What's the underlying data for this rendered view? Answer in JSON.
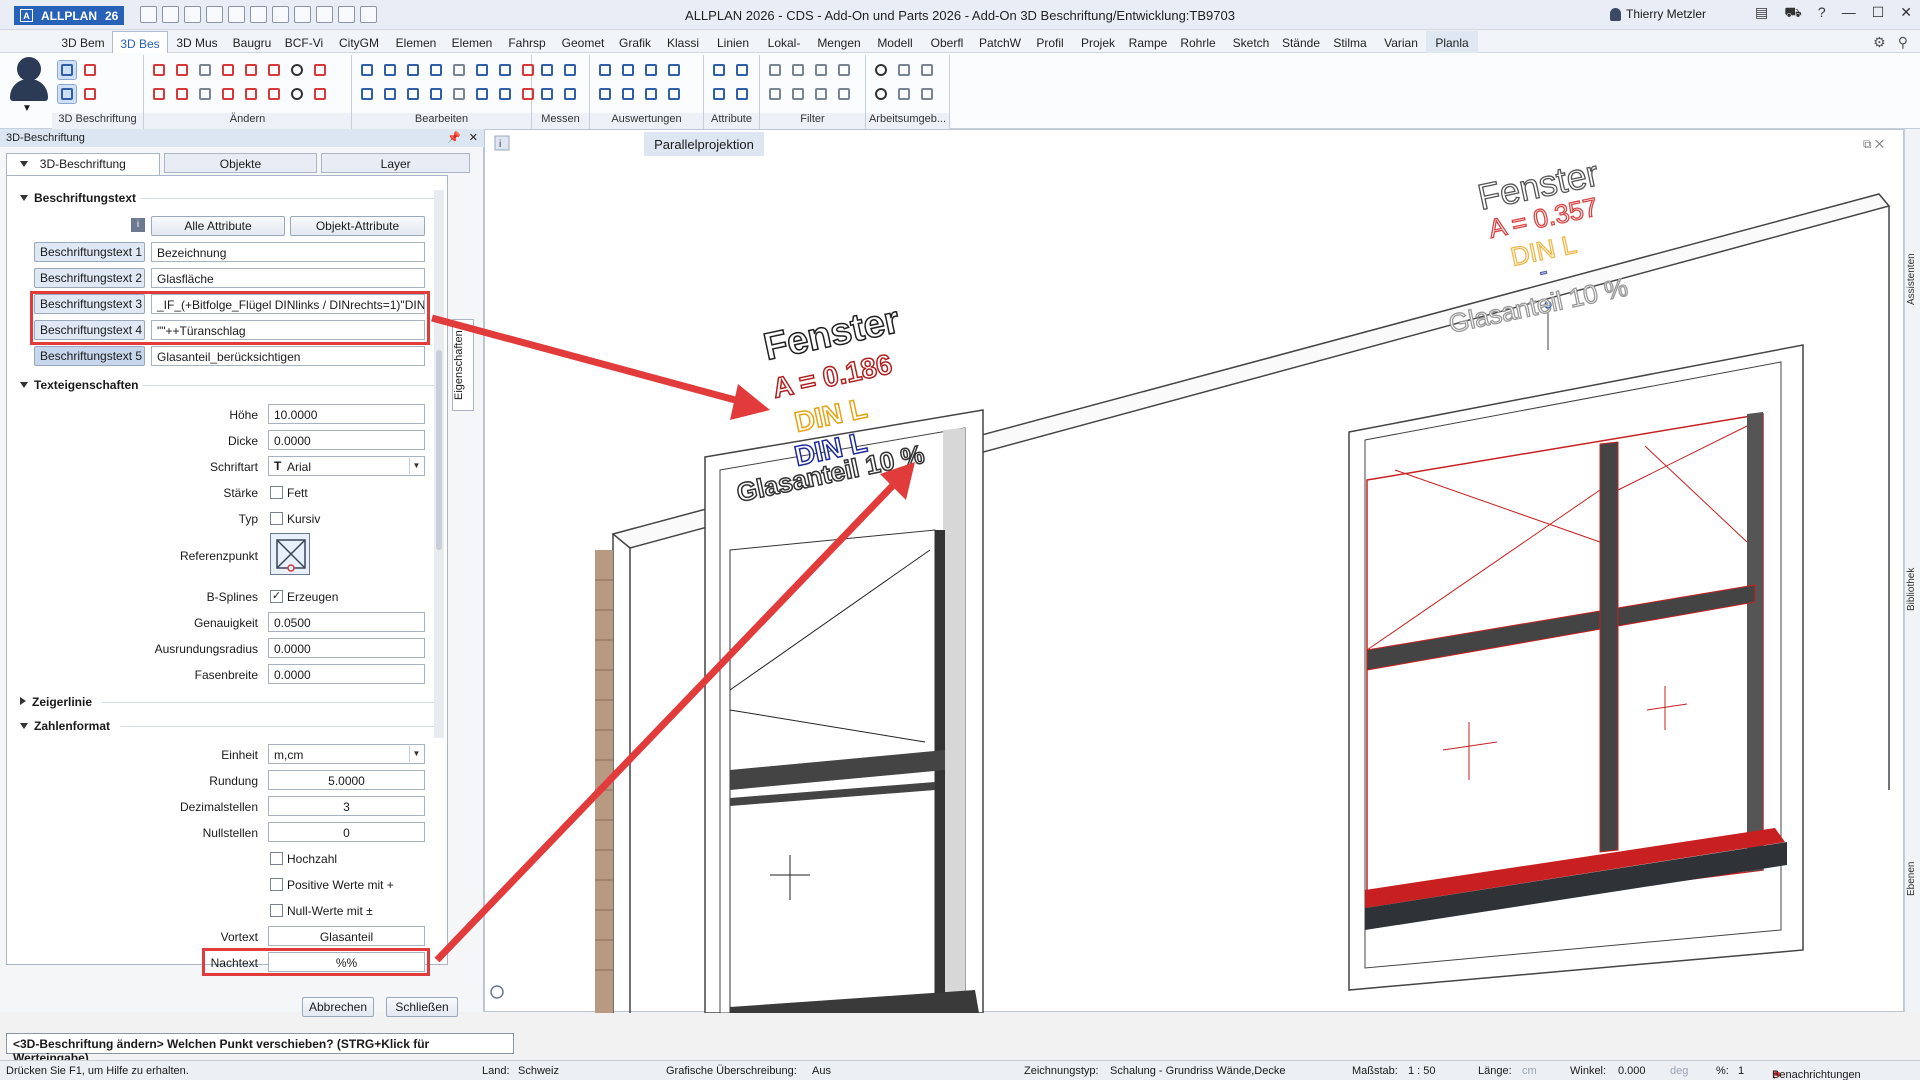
{
  "app": {
    "logo": "ALLPLAN",
    "version": "26",
    "window_title": "ALLPLAN 2026 - CDS - Add-On und Parts 2026 - Add-On 3D Beschriftung/Entwicklung:TB9703",
    "user": "Thierry Metzler"
  },
  "tabs": [
    "3D Bem",
    "3D Bes",
    "3D Mus",
    "Baugru",
    "BCF-Vi",
    "CityGM",
    "Elemen",
    "Elemen",
    "Fahrsp",
    "Geomet",
    "Grafik",
    "Klassi",
    "Linien",
    "Lokal-",
    "Mengen",
    "Modell",
    "Oberfl",
    "PatchW",
    "Profil",
    "Projek",
    "Rampe",
    "Rohrle",
    "Sketch",
    "Stände",
    "Stilma",
    "Varian",
    "Planla"
  ],
  "ribbon_groups": [
    "3D Beschriftung",
    "Ändern",
    "Bearbeiten",
    "Messen",
    "Auswertungen",
    "Attribute",
    "Filter",
    "Arbeitsumgeb..."
  ],
  "panel": {
    "title": "3D-Beschriftung",
    "tabs": [
      "3D-Beschriftung",
      "Objekte",
      "Layer"
    ],
    "side_tab": "Eigenschaften",
    "sections": {
      "beschriftungstext": "Beschriftungstext",
      "texteigenschaften": "Texteigenschaften",
      "zeigerlinie": "Zeigerlinie",
      "zahlenformat": "Zahlenformat"
    },
    "attr_buttons": [
      "Alle Attribute",
      "Objekt-Attribute"
    ],
    "texts": [
      {
        "label": "Beschriftungstext 1",
        "value": "Bezeichnung"
      },
      {
        "label": "Beschriftungstext 2",
        "value": "Glasfläche"
      },
      {
        "label": "Beschriftungstext 3",
        "value": "_IF_(+Bitfolge_Flügel DINlinks / DINrechts=1)\"DIN"
      },
      {
        "label": "Beschriftungstext 4",
        "value": "\"\"++Türanschlag"
      },
      {
        "label": "Beschriftungstext 5",
        "value": "Glasanteil_berücksichtigen"
      }
    ],
    "props": {
      "hoehe": {
        "label": "Höhe",
        "value": "10.0000"
      },
      "dicke": {
        "label": "Dicke",
        "value": "0.0000"
      },
      "schriftart": {
        "label": "Schriftart",
        "value": "Arial"
      },
      "staerke": {
        "label": "Stärke",
        "check": "Fett"
      },
      "typ": {
        "label": "Typ",
        "check": "Kursiv"
      },
      "referenzpunkt": {
        "label": "Referenzpunkt"
      },
      "bsplines": {
        "label": "B-Splines",
        "check": "Erzeugen"
      },
      "genauigkeit": {
        "label": "Genauigkeit",
        "value": "0.0500"
      },
      "ausrundung": {
        "label": "Ausrundungsradius",
        "value": "0.0000"
      },
      "fase": {
        "label": "Fasenbreite",
        "value": "0.0000"
      }
    },
    "zahlen": {
      "einheit": {
        "label": "Einheit",
        "value": "m,cm"
      },
      "rundung": {
        "label": "Rundung",
        "value": "5.0000"
      },
      "dezimal": {
        "label": "Dezimalstellen",
        "value": "3"
      },
      "null": {
        "label": "Nullstellen",
        "value": "0"
      },
      "hochzahl": "Hochzahl",
      "positiv": "Positive Werte mit +",
      "nullwerte": "Null-Werte mit ±",
      "vortext": {
        "label": "Vortext",
        "value": "Glasanteil"
      },
      "nachtext": {
        "label": "Nachtext",
        "value": "%%"
      }
    },
    "buttons": {
      "cancel": "Abbrechen",
      "close": "Schließen"
    }
  },
  "viewport": {
    "label": "Parallelprojektion",
    "right_tabs": [
      "Assistenten",
      "Bibliothek",
      "Ebenen"
    ],
    "label1": {
      "l1": "Fenster",
      "l2": "A = 0.186",
      "l3": "DIN L",
      "l4": "DIN L",
      "l5": "Glasanteil 10 %"
    },
    "label2": {
      "l1": "Fenster",
      "l2": "A = 0.357",
      "l3": "DIN L",
      "l4": "-",
      "l5": "Glasanteil 10 %"
    }
  },
  "command_prompt": "<3D-Beschriftung ändern> Welchen Punkt verschieben? (STRG+Klick für Werteingabe)",
  "status": {
    "help": "Drücken Sie F1, um Hilfe zu erhalten.",
    "land_label": "Land:",
    "land": "Schweiz",
    "overwrite_label": "Grafische Überschreibung:",
    "overwrite": "Aus",
    "drawtype_label": "Zeichnungstyp:",
    "drawtype": "Schalung  -  Grundriss Wände,Decke",
    "scale_label": "Maßstab:",
    "scale": "1 : 50",
    "length_label": "Länge:",
    "length_unit": "cm",
    "angle_label": "Winkel:",
    "angle": "0.000",
    "angle_unit": "deg",
    "pct_label": "%:",
    "pct": "1",
    "notifications": "Benachrichtungen"
  },
  "colors": {
    "accent": "#2762b8",
    "highlight": "#e23b3b",
    "text_red": "#b02121",
    "text_orange": "#e6a313",
    "text_blue": "#1c2b99"
  }
}
